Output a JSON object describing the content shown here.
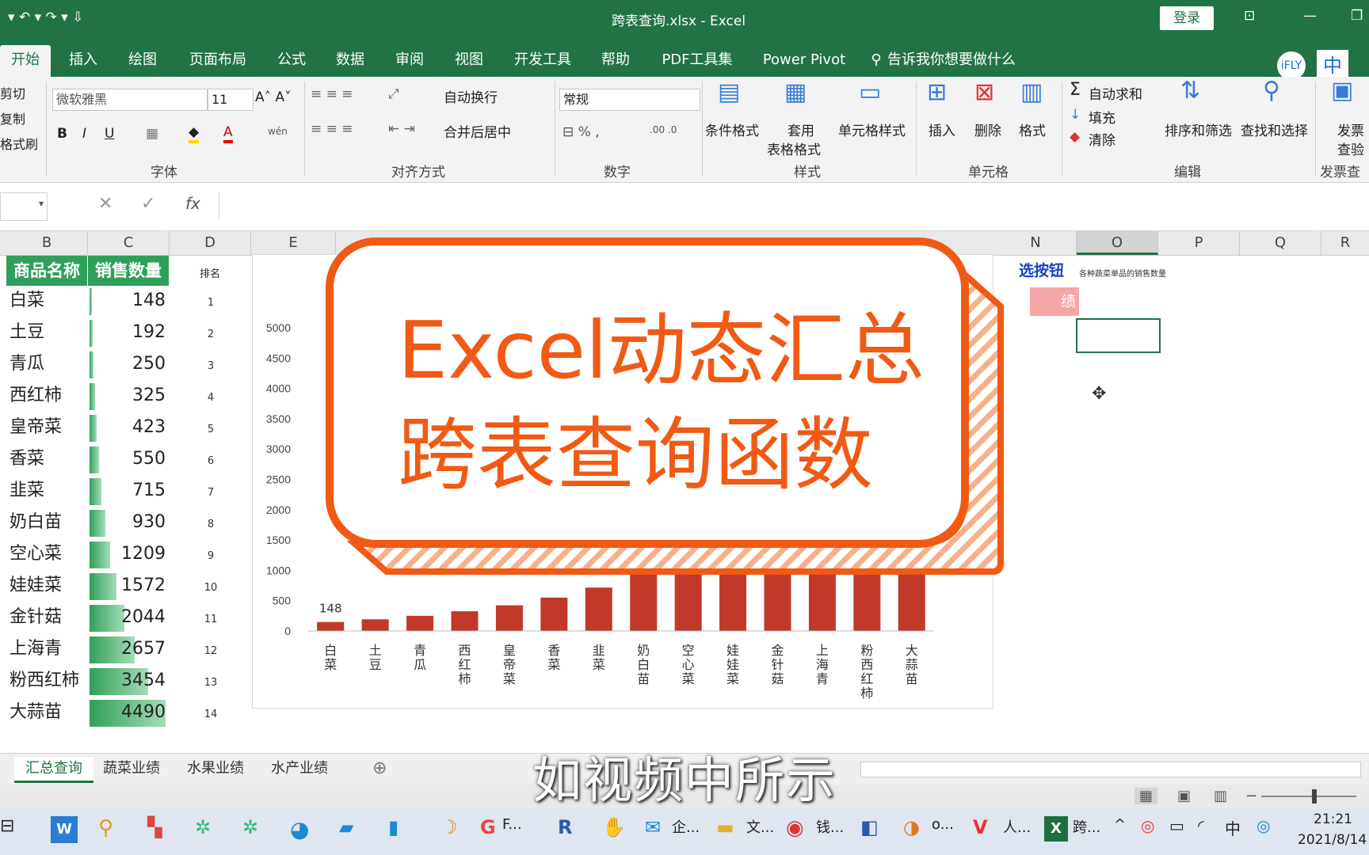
{
  "window": {
    "title": "跨表查询.xlsx  -  Excel",
    "login": "登录"
  },
  "tabs": [
    "开始",
    "插入",
    "绘图",
    "页面布局",
    "公式",
    "数据",
    "审阅",
    "视图",
    "开发工具",
    "帮助",
    "PDF工具集",
    "Power Pivot",
    "告诉我你想要做什么"
  ],
  "ribbon": {
    "clipboard": {
      "cut": "剪切",
      "copy": "复制",
      "format_painter": "格式刷"
    },
    "font": {
      "name": "微软雅黑",
      "size": "11",
      "group": "字体"
    },
    "align": {
      "wrap": "自动换行",
      "merge": "合并后居中",
      "group": "对齐方式"
    },
    "number": {
      "format": "常规",
      "group": "数字"
    },
    "styles": {
      "cond": "条件格式",
      "table_l1": "套用",
      "table_l2": "表格格式",
      "cell": "单元格样式",
      "group": "样式"
    },
    "cells": {
      "insert": "插入",
      "delete": "删除",
      "format": "格式",
      "group": "单元格"
    },
    "editing": {
      "autosum": "自动求和",
      "fill": "填充",
      "clear": "清除",
      "sort": "排序和筛选",
      "find": "查找和选择",
      "group": "编辑"
    },
    "invoice": {
      "l1": "发票",
      "l2": "查验",
      "group": "发票查验"
    },
    "ime": "中"
  },
  "formula": {
    "fx": "fx"
  },
  "columns": [
    "B",
    "C",
    "D",
    "E",
    "N",
    "O",
    "P",
    "Q",
    "R"
  ],
  "table": {
    "header_name": "商品名称",
    "header_qty": "销售数量",
    "header_rank": "排名",
    "rows": [
      {
        "name": "白菜",
        "qty": "148",
        "rank": "1"
      },
      {
        "name": "土豆",
        "qty": "192",
        "rank": "2"
      },
      {
        "name": "青瓜",
        "qty": "250",
        "rank": "3"
      },
      {
        "name": "西红柿",
        "qty": "325",
        "rank": "4"
      },
      {
        "name": "皇帝菜",
        "qty": "423",
        "rank": "5"
      },
      {
        "name": "香菜",
        "qty": "550",
        "rank": "6"
      },
      {
        "name": "韭菜",
        "qty": "715",
        "rank": "7"
      },
      {
        "name": "奶白苗",
        "qty": "930",
        "rank": "8"
      },
      {
        "name": "空心菜",
        "qty": "1209",
        "rank": "9"
      },
      {
        "name": "娃娃菜",
        "qty": "1572",
        "rank": "10"
      },
      {
        "name": "金针菇",
        "qty": "2044",
        "rank": "11"
      },
      {
        "name": "上海青",
        "qty": "2657",
        "rank": "12"
      },
      {
        "name": "粉西红柿",
        "qty": "3454",
        "rank": "13"
      },
      {
        "name": "大蒜苗",
        "qty": "4490",
        "rank": "14"
      }
    ]
  },
  "side": {
    "button_fragment": "选按钮",
    "pink_fragment": "绩",
    "note": "各种蔬菜单品的销售数量"
  },
  "chart_data": {
    "type": "bar",
    "categories": [
      "白菜",
      "土豆",
      "青瓜",
      "西红柿",
      "皇帝菜",
      "香菜",
      "韭菜",
      "奶白苗",
      "空心菜",
      "娃娃菜",
      "金针菇",
      "上海青",
      "粉西红柿",
      "大蒜苗"
    ],
    "values": [
      148,
      192,
      250,
      325,
      423,
      550,
      715,
      930,
      1209,
      1572,
      2044,
      2657,
      3454,
      4490
    ],
    "yticks": [
      0,
      500,
      1000,
      1500,
      2000,
      2500,
      3000,
      3500,
      4000,
      4500,
      5000
    ],
    "ylim": [
      0,
      5000
    ],
    "visible_label": "148",
    "bar_color": "#c0392b"
  },
  "overlay": {
    "line1": "Excel动态汇总",
    "line2": "跨表查询函数",
    "color": "#f05a14"
  },
  "sheets": [
    "汇总查询",
    "蔬菜业绩",
    "水果业绩",
    "水产业绩"
  ],
  "subtitle": "如视频中所示",
  "taskbar": {
    "items": [
      "F...",
      "企...",
      "文...",
      "钱...",
      "o...",
      "人...",
      "跨..."
    ],
    "time": "21:21",
    "date": "2021/8/14",
    "ime": "中"
  }
}
